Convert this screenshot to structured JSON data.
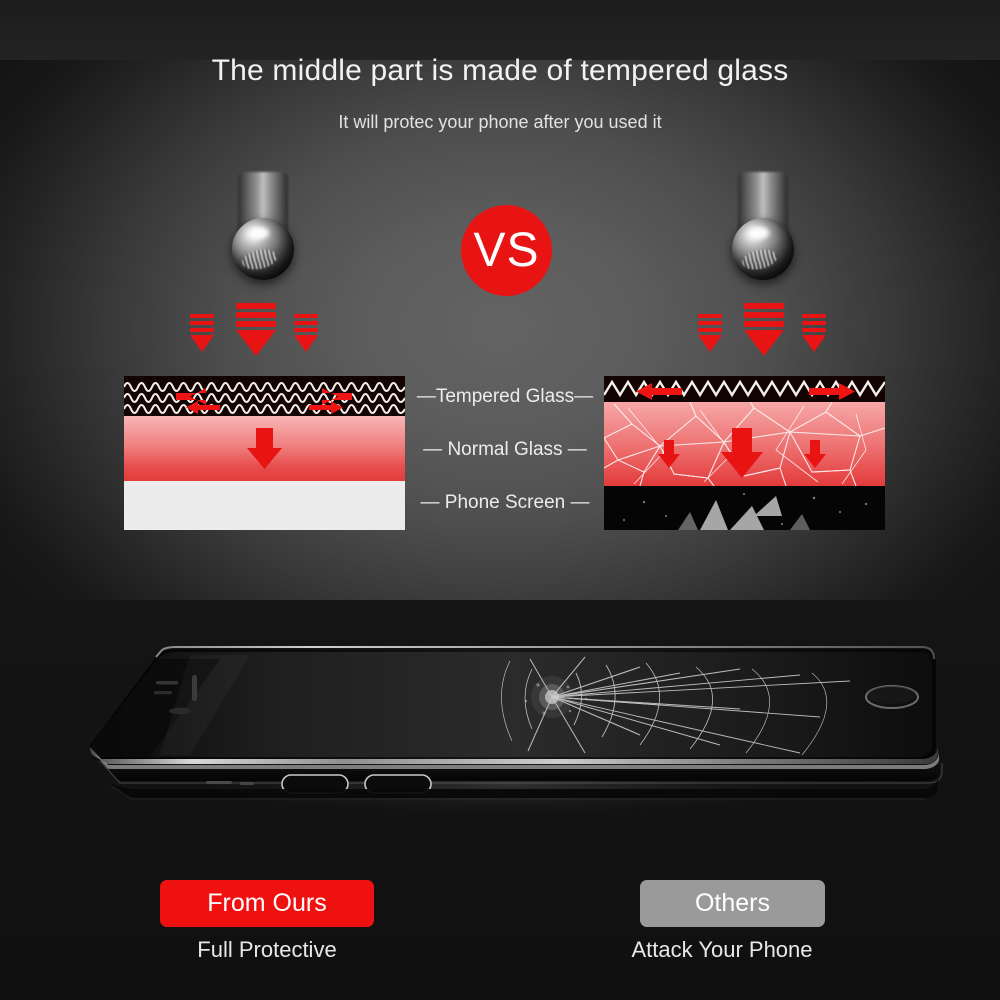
{
  "header": {
    "title": "The middle part is made of tempered glass",
    "subtitle": "It will protec your phone after you used it"
  },
  "vs_badge": {
    "label": "VS",
    "color": "#e81414"
  },
  "center_labels": [
    {
      "name": "tempered-glass",
      "text": "—Tempered Glass—"
    },
    {
      "name": "normal-glass",
      "text": "— Normal Glass —"
    },
    {
      "name": "phone-screen",
      "text": "— Phone Screen —"
    }
  ],
  "comparison": {
    "left": {
      "side": "protected",
      "impact_arrows": 3,
      "layers": [
        {
          "name": "tempered-glass-layer",
          "state": "intact-wavy",
          "color": "#140303"
        },
        {
          "name": "normal-glass-layer",
          "state": "intact",
          "color": "#ef7a7a"
        },
        {
          "name": "phone-screen-layer",
          "state": "intact",
          "color": "#ececed"
        }
      ],
      "dispersion": "force-spread-sideways"
    },
    "right": {
      "side": "unprotected",
      "impact_arrows": 3,
      "layers": [
        {
          "name": "tempered-glass-layer",
          "state": "thin-zigzag",
          "color": "#140303"
        },
        {
          "name": "normal-glass-layer",
          "state": "cracked",
          "color": "#ed6f6f"
        },
        {
          "name": "phone-screen-layer",
          "state": "shattered",
          "color": "#050505"
        }
      ],
      "dispersion": "force-penetrates-down"
    }
  },
  "product_photo": {
    "left_half": "intact-screen",
    "right_half": "cracked-screen"
  },
  "footer": {
    "ours": {
      "badge": "From Ours",
      "caption": "Full Protective",
      "color": "#ef1010"
    },
    "others": {
      "badge": "Others",
      "caption": "Attack Your Phone",
      "color": "#9a9a9a"
    }
  }
}
